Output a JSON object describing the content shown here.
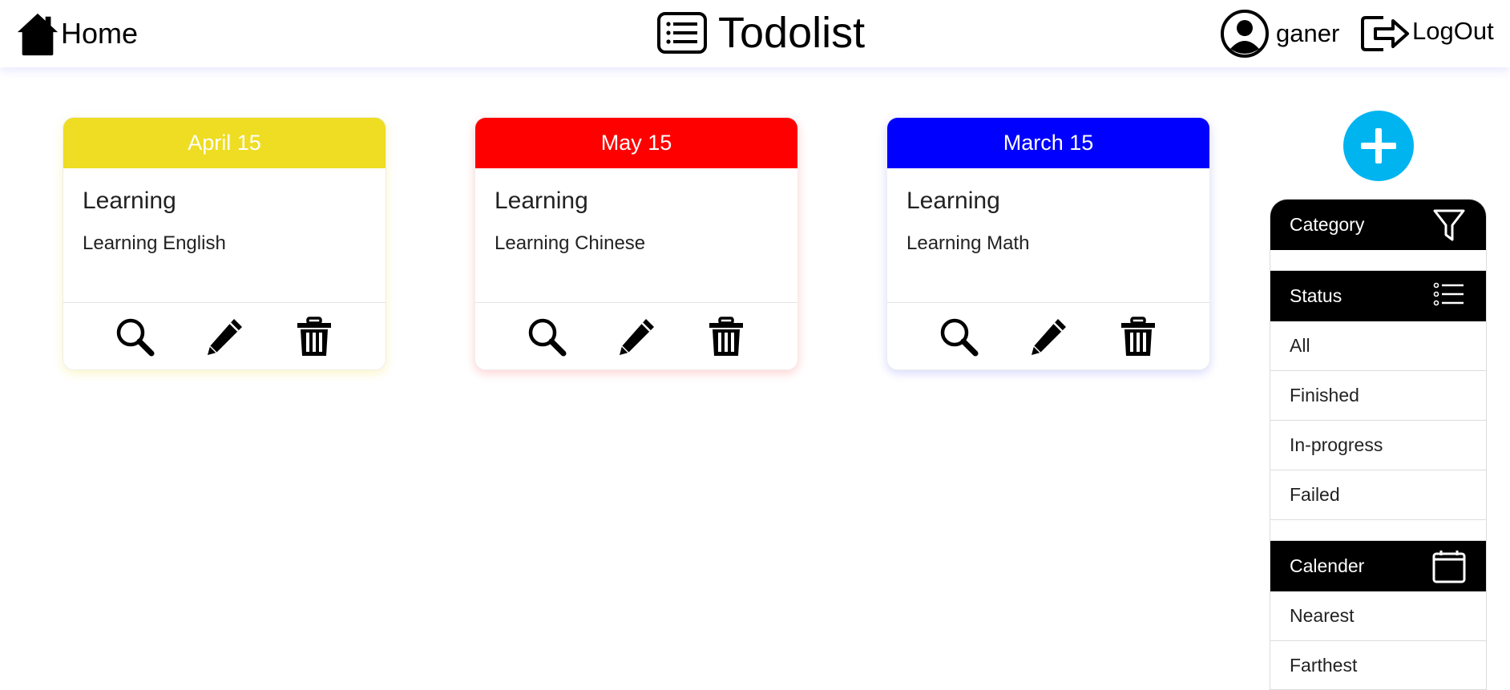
{
  "header": {
    "home_label": "Home",
    "app_title": "Todolist",
    "username": "ganer",
    "logout_label": "LogOut"
  },
  "cards": [
    {
      "date": "April 15",
      "title": "Learning",
      "description": "Learning English",
      "color": "#eedd22",
      "shadow": "rgba(238,221,34,0.25)"
    },
    {
      "date": "May 15",
      "title": "Learning",
      "description": "Learning Chinese",
      "color": "#ff0000",
      "shadow": "rgba(255,0,0,0.18)"
    },
    {
      "date": "March 15",
      "title": "Learning",
      "description": "Learning Math",
      "color": "#0000ff",
      "shadow": "rgba(0,0,255,0.15)"
    }
  ],
  "card_actions": [
    "search-icon",
    "pencil-icon",
    "trash-icon"
  ],
  "add_button": {
    "icon": "plus-icon",
    "color": "#00b4f0"
  },
  "sidebar": {
    "category": {
      "label": "Category",
      "icon": "funnel-icon"
    },
    "status": {
      "label": "Status",
      "icon": "list-icon",
      "items": [
        "All",
        "Finished",
        "In-progress",
        "Failed"
      ]
    },
    "calender": {
      "label": "Calender",
      "icon": "calendar-icon",
      "items": [
        "Nearest",
        "Farthest"
      ]
    }
  }
}
